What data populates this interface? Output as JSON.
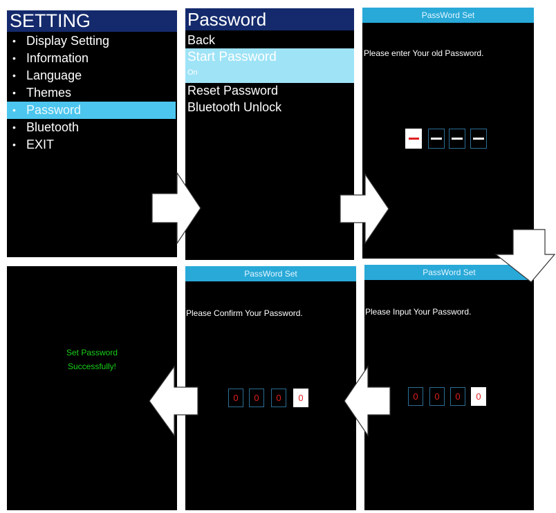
{
  "setting_menu": {
    "title": "SETTING",
    "items": [
      "Display Setting",
      "Information",
      "Language",
      "Themes",
      "Password",
      "Bluetooth",
      "EXIT"
    ],
    "selected": "Password"
  },
  "password_menu": {
    "title": "Password",
    "back": "Back",
    "start_password": "Start Password",
    "start_password_state": "On",
    "reset_password": "Reset Password",
    "bluetooth_unlock": "Bluetooth Unlock"
  },
  "old_password_screen": {
    "header": "PassWord Set",
    "prompt": "Please enter Your old Password."
  },
  "input_password_screen": {
    "header": "PassWord Set",
    "prompt": "Please Input Your Password.",
    "digits": [
      "0",
      "0",
      "0",
      "0"
    ]
  },
  "confirm_password_screen": {
    "header": "PassWord Set",
    "prompt": "Please Confirm Your Password.",
    "digits": [
      "0",
      "0",
      "0",
      "0"
    ]
  },
  "success_screen": {
    "line1": "Set Password",
    "line2": "Successfully!"
  },
  "colors": {
    "title_bar": "#142a6c",
    "selection": "#4cc6ee",
    "header_bar": "#29a9d8",
    "digit": "#e02020",
    "success_text": "#19d119"
  }
}
